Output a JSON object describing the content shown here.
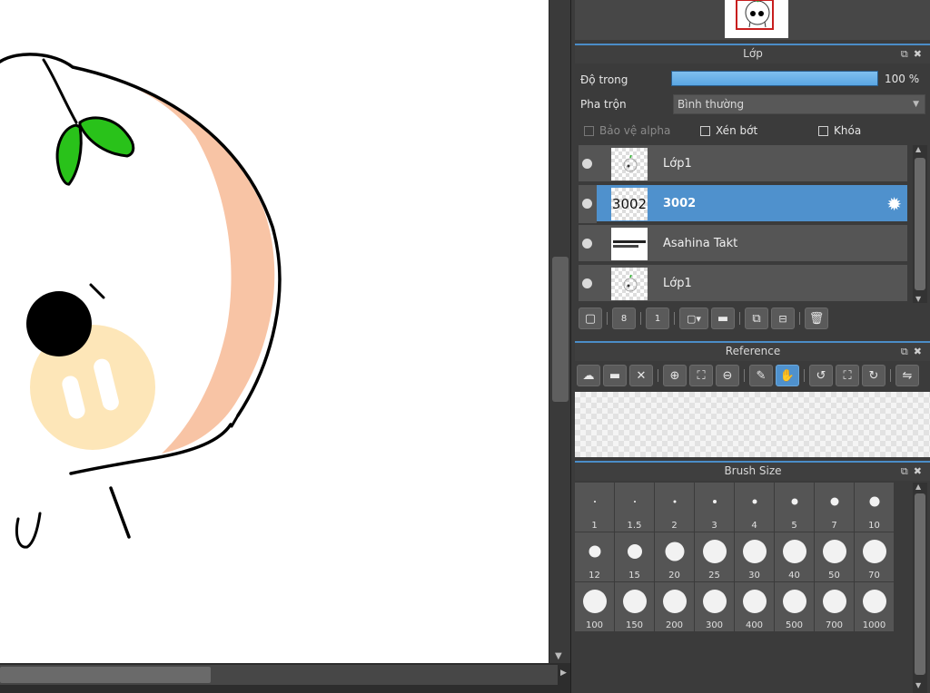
{
  "layer_panel": {
    "title": "Lớp",
    "opacity_label": "Độ trong",
    "opacity_value": "100 %",
    "opacity_level": 1.0,
    "blend_label": "Pha trộn",
    "blend_value": "Bình thường",
    "protect_alpha": "Bảo vệ alpha",
    "clipping": "Xén bớt",
    "lock": "Khóa",
    "layers": [
      {
        "name": "Lớp1",
        "thumb": "",
        "selected": false
      },
      {
        "name": "3002",
        "thumb": "3002",
        "selected": true
      },
      {
        "name": "Asahina Takt",
        "thumb": "",
        "selected": false
      },
      {
        "name": "Lớp1",
        "thumb": "",
        "selected": false
      }
    ],
    "toolbar_icons": [
      "new-layer-icon",
      "new-8bit-layer-icon",
      "new-1bit-layer-icon",
      "add-layer-menu-icon",
      "new-folder-icon",
      "duplicate-layer-icon",
      "merge-down-icon",
      "delete-layer-icon"
    ]
  },
  "reference_panel": {
    "title": "Reference",
    "toolbar_icons": [
      "open-cloud-icon",
      "open-folder-icon",
      "close-icon",
      "zoom-in-icon",
      "fit-icon",
      "zoom-out-icon",
      "eyedropper-icon",
      "hand-icon",
      "rotate-left-icon",
      "fullscreen-icon",
      "rotate-right-icon",
      "flip-icon"
    ]
  },
  "brush_panel": {
    "title": "Brush Size",
    "sizes": [
      "1",
      "1.5",
      "2",
      "3",
      "4",
      "5",
      "7",
      "10",
      "12",
      "15",
      "20",
      "25",
      "30",
      "40",
      "50",
      "70",
      "100",
      "150",
      "200",
      "300",
      "400",
      "500",
      "700",
      "1000"
    ]
  },
  "colors": {
    "accent": "#4f91cd",
    "panel_bg": "#3b3b3b",
    "cell_bg": "#555555"
  }
}
